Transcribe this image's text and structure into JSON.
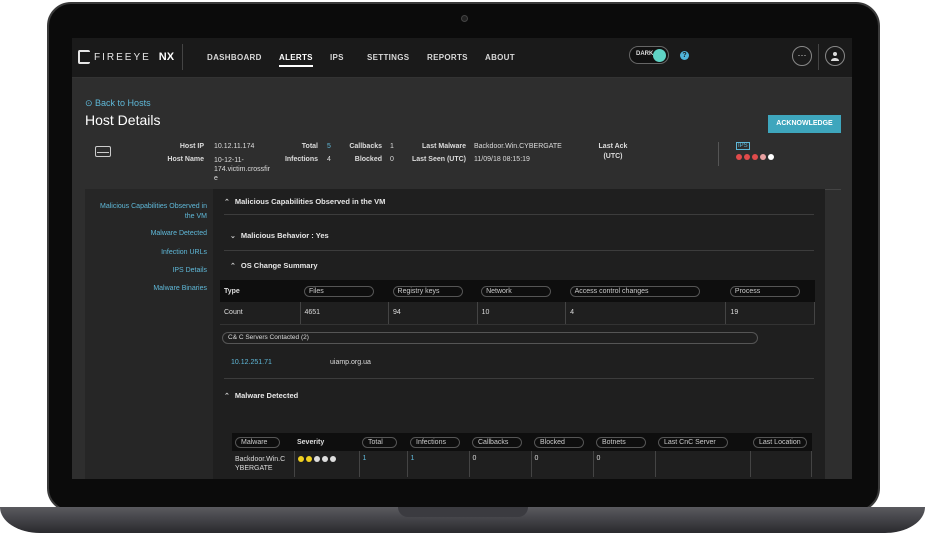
{
  "nav": {
    "brand": "FIREEYE",
    "product": "NX",
    "items": [
      "DASHBOARD",
      "ALERTS",
      "IPS",
      "SETTINGS",
      "REPORTS",
      "ABOUT"
    ],
    "active": "ALERTS",
    "theme_toggle_label": "DARK",
    "help_icon": "?",
    "menu_icon": "···",
    "user_icon": "person-icon"
  },
  "header": {
    "back_label": "Back to Hosts",
    "title": "Host Details",
    "acknowledge_label": "ACKNOWLEDGE"
  },
  "host": {
    "ip_label": "Host IP",
    "ip": "10.12.11.174",
    "name_label": "Host Name",
    "name_lines": [
      "10-12-11-",
      "174.victim.crossfir",
      "e"
    ],
    "total_label": "Total",
    "total": "5",
    "infections_label": "Infections",
    "infections": "4",
    "callbacks_label": "Callbacks",
    "callbacks": "1",
    "blocked_label": "Blocked",
    "blocked": "0",
    "last_malware_label": "Last Malware",
    "last_malware": "Backdoor.Win.CYBERGATE",
    "last_seen_label": "Last Seen (UTC)",
    "last_seen": "11/09/18 08:15:19",
    "last_ack_label_1": "Last Ack",
    "last_ack_label_2": "(UTC)",
    "ips_tag": "IPS",
    "severity_colors": [
      "#e04b4b",
      "#e04b4b",
      "#e04b4b",
      "#e8a0a0",
      "#ffffff"
    ]
  },
  "sidebar": {
    "items": [
      "Malicious Capabilities Observed in the VM",
      "Malware Detected",
      "Infection URLs",
      "IPS Details",
      "Malware Binaries"
    ]
  },
  "sections": {
    "capabilities": "Malicious Capabilities Observed in the VM",
    "behavior": "Malicious Behavior : Yes",
    "os_change": "OS Change Summary",
    "malware_detected": "Malware Detected"
  },
  "os_table": {
    "type_header": "Type",
    "columns": [
      "Files",
      "Registry keys",
      "Network",
      "Access control changes",
      "Process"
    ],
    "row_label": "Count",
    "values": [
      "4651",
      "94",
      "10",
      "4",
      "19"
    ]
  },
  "cnc": {
    "label": "C& C Servers Contacted (2)",
    "ip": "10.12.251.71",
    "domain": "uiamp.org.ua"
  },
  "malware_table": {
    "columns": [
      "Malware",
      "Severity",
      "Total",
      "Infections",
      "Callbacks",
      "Blocked",
      "Botnets",
      "Last CnC Server",
      "Last Location"
    ],
    "rows": [
      {
        "malware_lines": [
          "Backdoor.Win.C",
          "YBERGATE"
        ],
        "severity_colors": [
          "#f0d020",
          "#f0d020",
          "#dddddd",
          "#dddddd",
          "#dddddd"
        ],
        "total": "1",
        "infections": "1",
        "callbacks": "0",
        "blocked": "0",
        "botnets": "0",
        "last_cnc": "",
        "last_location": ""
      }
    ]
  }
}
